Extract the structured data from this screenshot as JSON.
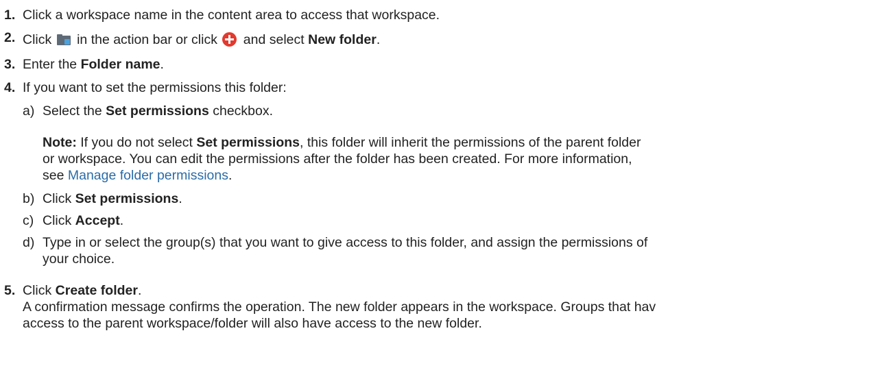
{
  "steps": {
    "s1": {
      "num": "1.",
      "text": "Click a workspace name in the content area to access that workspace."
    },
    "s2": {
      "num": "2.",
      "pre": "Click",
      "mid": "in the action bar or click",
      "post1": "and select",
      "bold": "New folder",
      "post2": "."
    },
    "s3": {
      "num": "3.",
      "pre": "Enter the",
      "bold": "Folder name",
      "post": "."
    },
    "s4": {
      "num": "4.",
      "text": "If you want to set the permissions this folder:"
    },
    "s5": {
      "num": "5.",
      "pre": "Click",
      "bold": "Create folder",
      "post": ".",
      "result_line1": "A confirmation message confirms the operation. The new folder appears in the workspace. Groups that hav",
      "result_line2": "access to the parent workspace/folder will also have access to the new folder."
    }
  },
  "substeps": {
    "a": {
      "letter": "a)",
      "pre": "Select the",
      "bold": "Set permissions",
      "post": "checkbox."
    },
    "b": {
      "letter": "b)",
      "pre": "Click",
      "bold": "Set permissions",
      "post": "."
    },
    "c": {
      "letter": "c)",
      "pre": "Click",
      "bold": "Accept",
      "post": "."
    },
    "d": {
      "letter": "d)",
      "line1": "Type in or select the group(s) that you want to give access to this folder, and assign the permissions of",
      "line2": "your choice."
    }
  },
  "note": {
    "label": "Note:",
    "pre": "If you do not select",
    "bold": "Set permissions",
    "line1_post": ", this folder will inherit the permissions of the parent folder",
    "line2": "or workspace. You can edit the permissions after the folder has been created. For more information,",
    "line3_pre": "see",
    "link": "Manage folder permissions",
    "line3_post": "."
  },
  "icons": {
    "new_folder": "new-folder-icon",
    "add": "add-circle-icon"
  }
}
